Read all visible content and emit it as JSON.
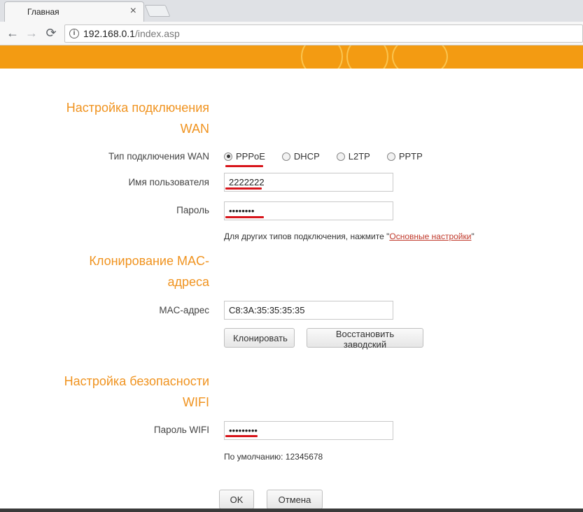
{
  "browser": {
    "tab_title": "Главная",
    "tab_close": "×",
    "url_host": "192.168.0.1",
    "url_path": "/index.asp",
    "back_icon": "←",
    "forward_icon": "→",
    "reload_icon": "⟳",
    "info_icon": "i"
  },
  "colors": {
    "accent": "#f39b12",
    "section_title": "#f0931f",
    "underline": "#d8151b"
  },
  "wan": {
    "title_line1": "Настройка подключения",
    "title_line2": "WAN",
    "type_label": "Тип подключения WAN",
    "options": [
      "PPPoE",
      "DHCP",
      "L2TP",
      "PPTP"
    ],
    "selected": "PPPoE",
    "username_label": "Имя пользователя",
    "username_value": "2222222",
    "password_label": "Пароль",
    "password_value": "••••••••",
    "hint_text": "Для других типов подключения, нажмите \"",
    "hint_link": "Основные настройки",
    "hint_end": "\""
  },
  "mac": {
    "title_line1": "Клонирование MAC-",
    "title_line2": "адреса",
    "address_label": "MAC-адрес",
    "address_value": "C8:3A:35:35:35:35",
    "clone_button": "Клонировать",
    "restore_button": "Восстановить заводский"
  },
  "wifi": {
    "title_line1": "Настройка безопасности",
    "title_line2": "WIFI",
    "password_label": "Пароль WIFI",
    "password_value": "•••••••••",
    "default_hint": "По умолчанию: 12345678"
  },
  "footer": {
    "ok_button": "OK",
    "cancel_button": "Отмена"
  }
}
